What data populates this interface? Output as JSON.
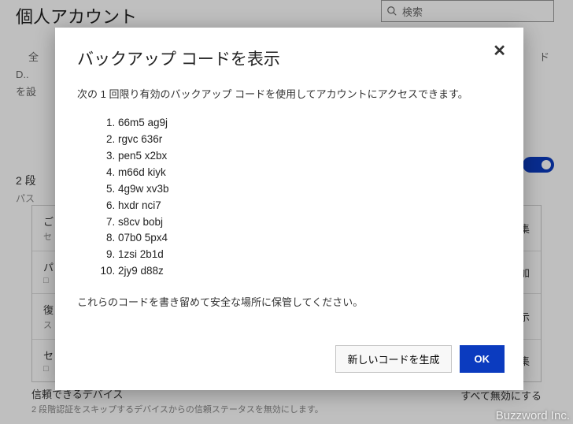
{
  "page": {
    "title": "個人アカウント",
    "search_placeholder": "検索",
    "bg_nav_item": "全",
    "bg_line1": "D..",
    "bg_line2": "を設",
    "bg_nav_right": "ド",
    "section2_title": "2 段",
    "section2_sub": "パス",
    "card_rows": [
      {
        "title": "ご",
        "sub": "セ",
        "action": "集"
      },
      {
        "title": "パ",
        "sub": "□",
        "action": "加"
      },
      {
        "title": "復",
        "sub": "ス",
        "action": "示"
      },
      {
        "title": "セ",
        "sub": "□",
        "action": "集"
      }
    ],
    "trusted_title": "信頼できるデバイス",
    "trusted_sub": "2 段階認証をスキップするデバイスからの信頼ステータスを無効にします。",
    "trusted_action": "すべて無効にする"
  },
  "modal": {
    "title": "バックアップ コードを表示",
    "desc": "次の 1 回限り有効のバックアップ コードを使用してアカウントにアクセスできます。",
    "codes": [
      "66m5 ag9j",
      "rgvc 636r",
      "pen5 x2bx",
      "m66d kiyk",
      "4g9w xv3b",
      "hxdr nci7",
      "s8cv bobj",
      "07b0 5px4",
      "1zsi 2b1d",
      "2jy9 d88z"
    ],
    "note": "これらのコードを書き留めて安全な場所に保管してください。",
    "regenerate_label": "新しいコードを生成",
    "ok_label": "OK",
    "close_label": "✕"
  },
  "watermark": "Buzzword Inc."
}
